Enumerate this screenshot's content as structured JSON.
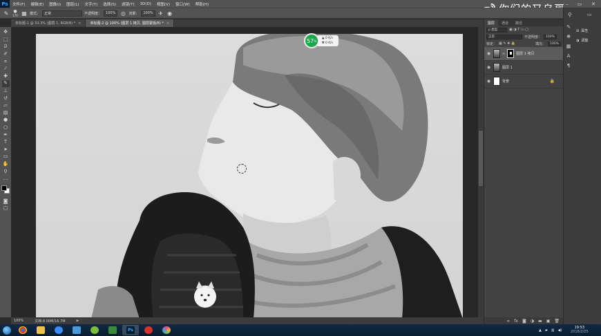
{
  "menubar": {
    "logo": "Ps",
    "items": [
      "文件(F)",
      "编辑(E)",
      "图像(I)",
      "图层(L)",
      "文字(Y)",
      "选择(S)",
      "滤镜(T)",
      "3D(D)",
      "视图(V)",
      "窗口(W)",
      "帮助(H)"
    ],
    "watermark": "你们的又乌哥"
  },
  "options": {
    "brush_size": "170",
    "mode_label": "模式：",
    "mode_value": "正常",
    "opacity_label": "不透明度：",
    "opacity_value": "100%",
    "flow_label": "流量：",
    "flow_value": "100%"
  },
  "tabs": [
    {
      "label": "未标题-1 @ 33.3% (图层 1, RGB/8) *",
      "active": false
    },
    {
      "label": "未标题-2 @ 100% (图层 1 拷贝, 图层蒙版/8) *",
      "active": true
    }
  ],
  "hud": {
    "percent": "57",
    "percent_sign": "%",
    "up": "0 K/s",
    "down": "0 K/s"
  },
  "status": {
    "zoom": "100%",
    "doc": "文档:8.00M/16.7M"
  },
  "panels": {
    "tabs": [
      "图层",
      "通道",
      "路径"
    ],
    "filter_label": "p 类型",
    "blend_mode": "正常",
    "opacity_label": "不透明度：",
    "opacity_value": "100%",
    "lock_label": "锁定：",
    "fill_label": "填充：",
    "fill_value": "100%",
    "layers": [
      {
        "name": "图层 1 拷贝",
        "selected": true,
        "thumb": "image",
        "mask": true,
        "locked": false
      },
      {
        "name": "图层 1",
        "selected": false,
        "thumb": "image",
        "mask": false,
        "locked": false
      },
      {
        "name": "背景",
        "selected": false,
        "thumb": "white",
        "mask": false,
        "locked": true
      }
    ]
  },
  "dock": {
    "properties": "属性",
    "adjustments": "调整"
  },
  "taskbar": {
    "time": "19:53",
    "date": "2018/2/25"
  },
  "colors": {
    "ps_blue": "#31a8ff",
    "hud_green": "#1aa84a",
    "panel_bg": "#424242",
    "menubar_bg": "#535353"
  }
}
